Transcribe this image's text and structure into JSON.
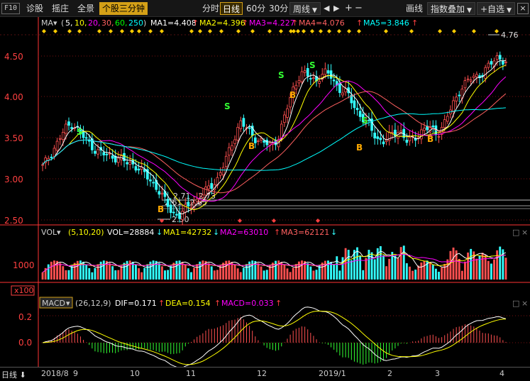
{
  "toolbar": {
    "f10": "F10",
    "items": [
      "诊股",
      "摇庄",
      "全景"
    ],
    "active_tab": "个股三分钟",
    "periods": [
      "分时",
      "日线",
      "60分",
      "30分"
    ],
    "selected_period": "日线",
    "week_dropdown": "周线",
    "right_menu": [
      "画线",
      "指数叠加",
      "+自选"
    ],
    "close": "×"
  },
  "main": {
    "legend": {
      "name": "MA",
      "params_open": "(",
      "params": [
        {
          "text": "5,",
          "color": "#ffffff"
        },
        {
          "text": "10,",
          "color": "#ffff00"
        },
        {
          "text": "20,",
          "color": "#ff00ff"
        },
        {
          "text": "30,",
          "color": "#ff6060"
        },
        {
          "text": "60,",
          "color": "#00ff00"
        },
        {
          "text": "250",
          "color": "#00ffff"
        }
      ],
      "params_close": ")",
      "values": [
        {
          "label": "MA1=4.408",
          "arrow": "↑",
          "color": "#ffffff"
        },
        {
          "label": "MA2=4.396",
          "arrow": "↑",
          "color": "#ffff00"
        },
        {
          "label": "MA3=4.227",
          "arrow": "↑",
          "color": "#ff00ff"
        },
        {
          "label": "MA4=4.076",
          "arrow": "↑",
          "color": "#ff6060"
        },
        {
          "label": "MA5=3.846",
          "arrow": "↑",
          "color": "#00ffff"
        }
      ]
    },
    "y_ticks": [
      "4.50",
      "4.00",
      "3.50",
      "3.00",
      "2.50"
    ],
    "annotations": {
      "high": "4.76",
      "low": "2.50",
      "fib1": "2.61 - 2.65",
      "fib2": "2.71 - 2.73"
    }
  },
  "vol": {
    "name": "VOL",
    "params": "(5,10,20)",
    "values": [
      {
        "label": "VOL=28884",
        "arrow": "↓",
        "color": "#ffffff"
      },
      {
        "label": "MA1=42732",
        "arrow": "↓",
        "color": "#ffff00"
      },
      {
        "label": "MA2=63010",
        "arrow": "↑",
        "color": "#ff00ff"
      },
      {
        "label": "MA3=62121",
        "arrow": "↓",
        "color": "#ff6060"
      }
    ],
    "y_tick": "1000",
    "unit": "x100"
  },
  "macd": {
    "name": "MACD",
    "params": "(26,12,9)",
    "values": [
      {
        "label": "DIF=0.171",
        "arrow": "↑",
        "color": "#ffffff"
      },
      {
        "label": "DEA=0.154",
        "arrow": "↑",
        "color": "#ffff00"
      },
      {
        "label": "MACD=0.033",
        "arrow": "↑",
        "color": "#ff00ff"
      }
    ],
    "y_ticks": [
      "0.2",
      "0.0"
    ]
  },
  "x_axis": {
    "period_dropdown": "日线",
    "dates": [
      "2018/8",
      "9",
      "10",
      "11",
      "12",
      "2019/1",
      "2",
      "3",
      "4"
    ]
  },
  "chart_data": {
    "type": "candlestick",
    "period": "daily",
    "y_ticks": [
      2.5,
      3.0,
      3.5,
      4.0,
      4.5
    ],
    "ylim": [
      2.4,
      4.85
    ],
    "high": 4.76,
    "low": 2.5,
    "last": {
      "MA1": 4.408,
      "MA2": 4.396,
      "MA3": 4.227,
      "MA4": 4.076,
      "MA5": 3.846
    },
    "close_path": [
      3.15,
      3.3,
      3.45,
      3.62,
      3.68,
      3.55,
      3.45,
      3.35,
      3.3,
      3.28,
      3.25,
      3.2,
      3.18,
      3.1,
      3.0,
      2.9,
      2.75,
      2.6,
      2.55,
      2.65,
      2.72,
      2.8,
      2.9,
      3.0,
      3.2,
      3.45,
      3.7,
      3.6,
      3.5,
      3.45,
      3.4,
      3.5,
      3.8,
      4.1,
      4.3,
      4.25,
      4.2,
      4.3,
      4.25,
      4.1,
      4.05,
      3.9,
      3.75,
      3.65,
      3.5,
      3.45,
      3.55,
      3.6,
      3.45,
      3.5,
      3.6,
      3.62,
      3.55,
      3.7,
      3.9,
      4.1,
      4.2,
      4.25,
      4.3,
      4.4,
      4.5,
      4.42
    ],
    "signals": [
      "S",
      "B",
      "S",
      "B",
      "S",
      "B",
      "S",
      "B",
      "S",
      "B"
    ],
    "vol_y_tick": 1000,
    "vol_last": {
      "VOL": 28884,
      "MA1": 42732,
      "MA2": 63010,
      "MA3": 62121
    },
    "macd_y_ticks": [
      0.2,
      0.0
    ],
    "macd_last": {
      "DIF": 0.171,
      "DEA": 0.154,
      "MACD": 0.033
    }
  },
  "colors": {
    "up": "#ff5050",
    "down": "#33ffff",
    "axis_text": "#ff4040",
    "ma5": "#ffffff",
    "ma10": "#ffff00",
    "ma20": "#ff00ff",
    "ma30": "#ff6060",
    "ma250": "#00ffff",
    "signal_s": "#33ff33",
    "signal_b": "#ffaa00",
    "accent": "#d4a017"
  }
}
